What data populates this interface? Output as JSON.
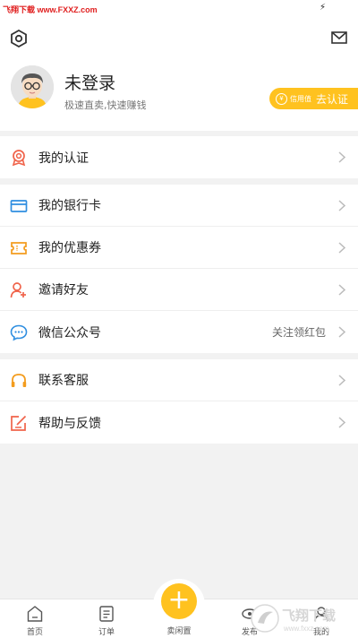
{
  "status_bar": {
    "watermark": "飞翔下载 www.FXXZ.com",
    "battery_glyph": "⚡"
  },
  "profile": {
    "name": "未登录",
    "subtitle": "极速直卖,快速赚钱",
    "verify_badge_small": "信用值",
    "verify_badge_label": "去认证"
  },
  "menu_groups": [
    {
      "items": [
        {
          "label": "我的认证",
          "icon": "certificate-icon",
          "color": "#f0634a"
        }
      ]
    },
    {
      "items": [
        {
          "label": "我的银行卡",
          "icon": "bank-card-icon",
          "color": "#2f8ee0"
        },
        {
          "label": "我的优惠券",
          "icon": "coupon-icon",
          "color": "#f39c1e"
        },
        {
          "label": "邀请好友",
          "icon": "invite-user-icon",
          "color": "#f0634a"
        },
        {
          "label": "微信公众号",
          "icon": "wechat-icon",
          "color": "#2f8ee0",
          "extra": "关注领红包"
        }
      ]
    },
    {
      "items": [
        {
          "label": "联系客服",
          "icon": "headset-icon",
          "color": "#f39c1e"
        },
        {
          "label": "帮助与反馈",
          "icon": "feedback-icon",
          "color": "#f0634a"
        }
      ]
    }
  ],
  "bottom_nav": {
    "items": [
      {
        "label": "首页",
        "icon": "home-icon"
      },
      {
        "label": "订单",
        "icon": "order-icon"
      },
      {
        "label": "卖闲置",
        "icon": "plus-icon"
      },
      {
        "label": "发布",
        "icon": "publish-icon"
      },
      {
        "label": "我的",
        "icon": "user-icon"
      }
    ],
    "center_glyph": "+"
  },
  "watermark_logo": {
    "text": "飞翔下载",
    "url": "www.fxxz.com"
  },
  "colors": {
    "accent": "#ffc21f",
    "chevron": "#bbbbbb",
    "background": "#f2f2f2"
  }
}
